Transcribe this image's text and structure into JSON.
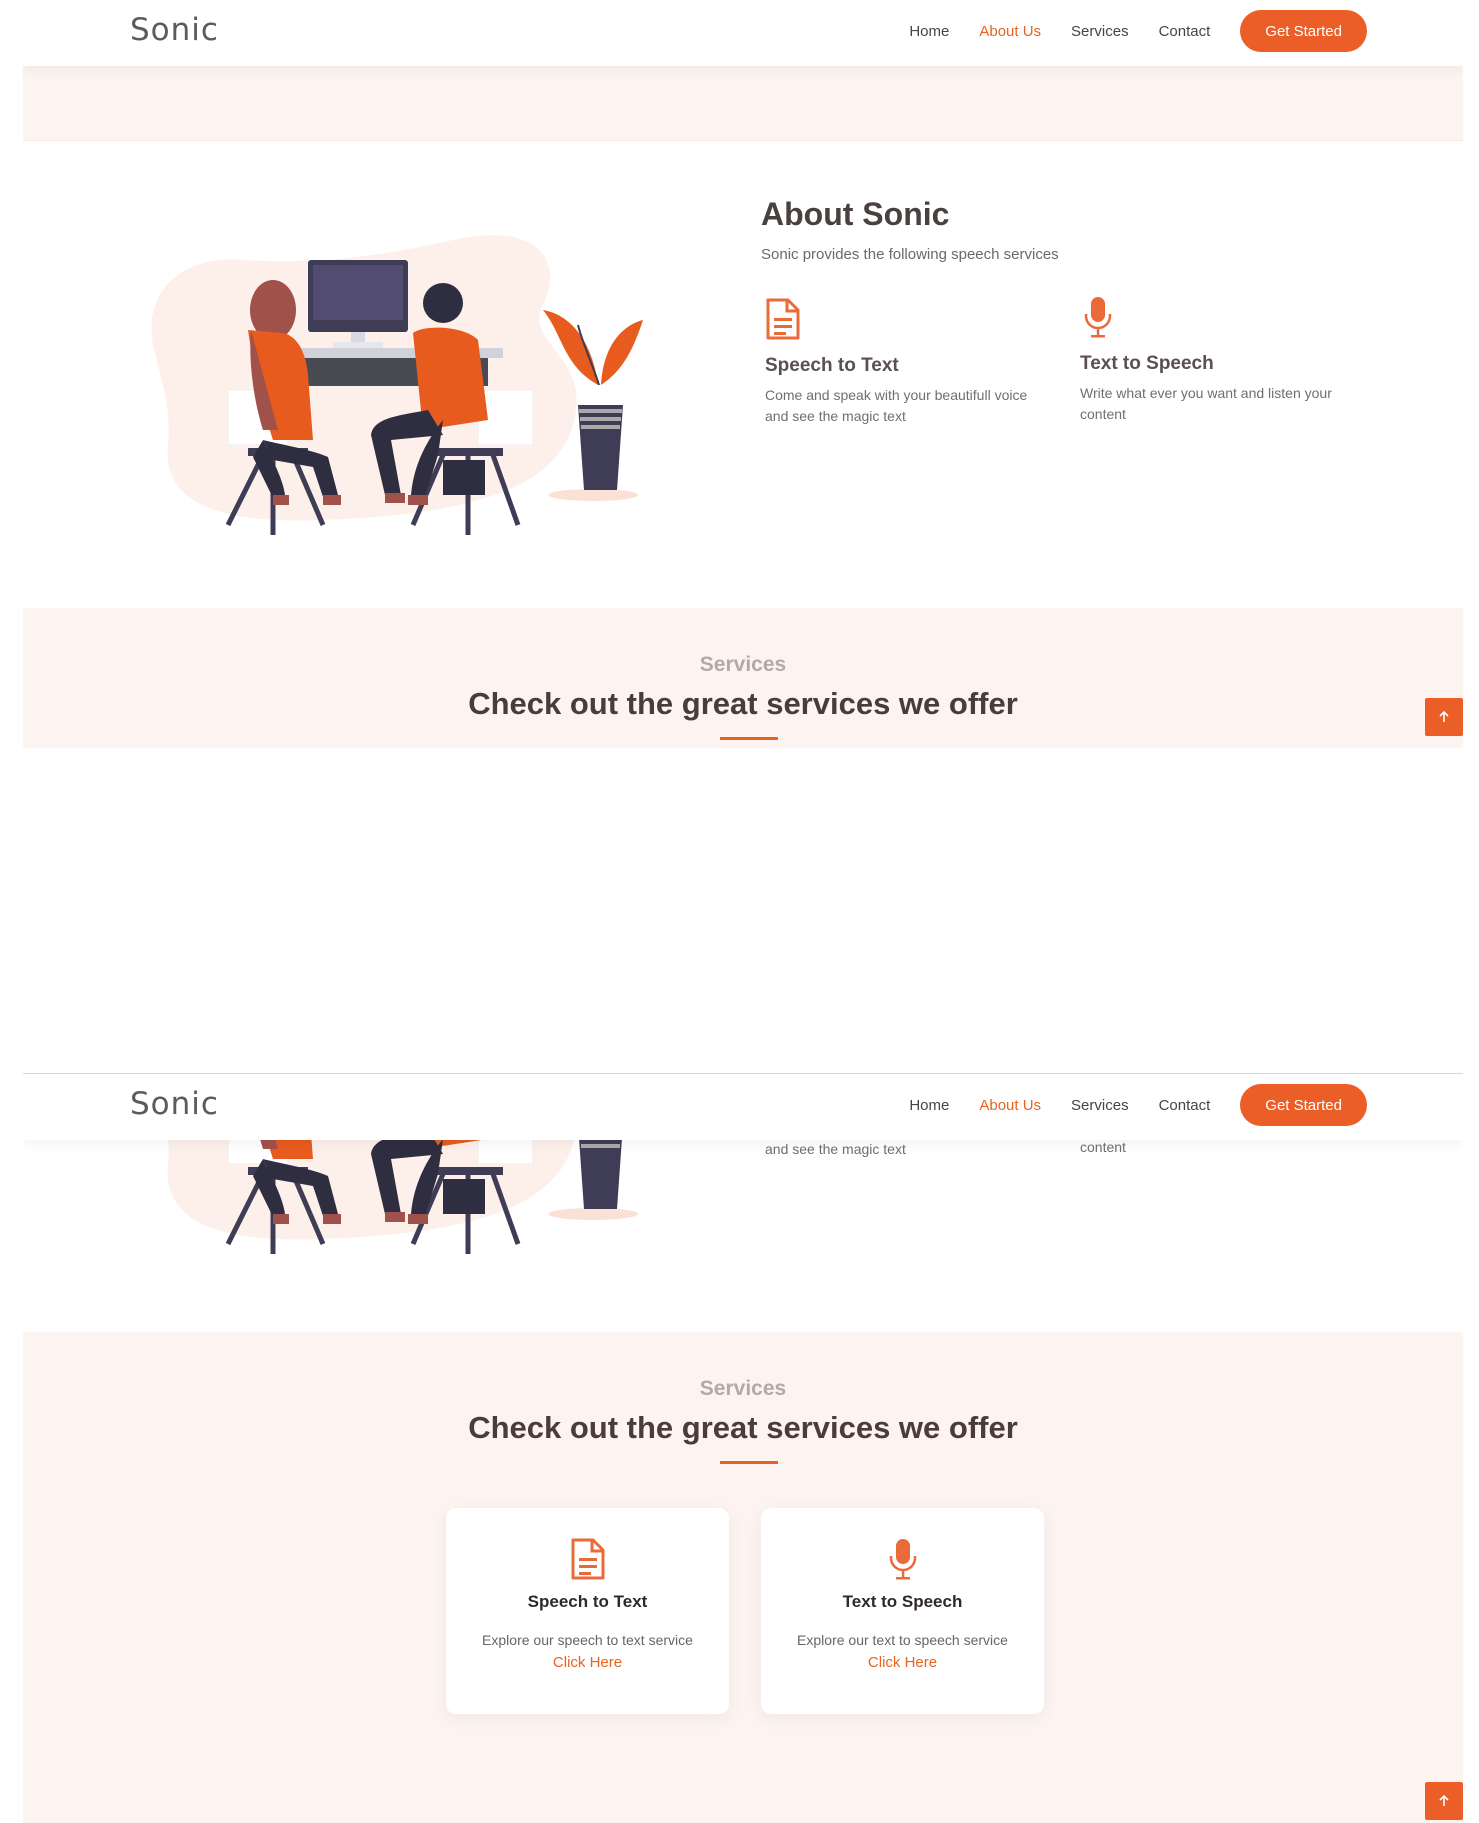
{
  "header": {
    "logo": "Sonic",
    "nav": [
      "Home",
      "About Us",
      "Services",
      "Contact"
    ],
    "active_nav": "About Us",
    "cta_label": "Get Started"
  },
  "about": {
    "title": "About Sonic",
    "subtitle": "Sonic provides the following speech services",
    "features": [
      {
        "icon": "document-icon",
        "title": "Speech to Text",
        "desc_line1": "Come and speak with your beautifull voice",
        "desc_line2": "and see the magic text"
      },
      {
        "icon": "microphone-icon",
        "title": "Text to Speech",
        "desc_line1": "Write what ever you want and listen your",
        "desc_line2": "content"
      }
    ]
  },
  "services": {
    "kicker": "Services",
    "title": "Check out the great services we offer",
    "cards": [
      {
        "icon": "document-icon",
        "title": "Speech to Text",
        "desc": "Explore our speech to text service",
        "link": "Click Here"
      },
      {
        "icon": "microphone-icon",
        "title": "Text to Speech",
        "desc": "Explore our text to speech service",
        "link": "Click Here"
      }
    ]
  },
  "back_to_top_icon": "arrow-up-icon",
  "colors": {
    "accent": "#eb5e28",
    "section_bg": "#fdf4f1",
    "heading": "#4b3c38"
  }
}
